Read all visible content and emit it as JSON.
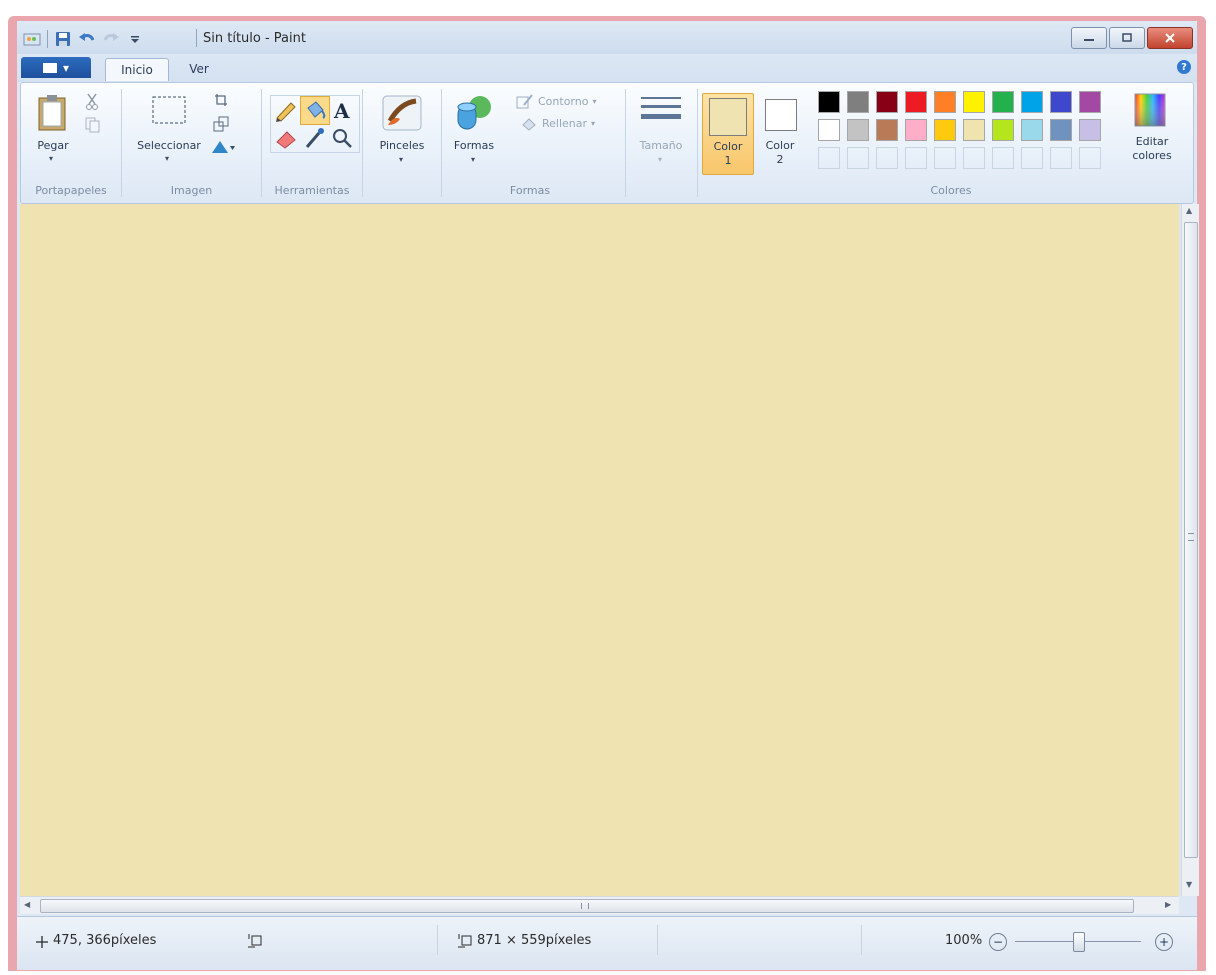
{
  "titlebar": {
    "title": "Sin título - Paint"
  },
  "tabs": {
    "inicio": "Inicio",
    "ver": "Ver"
  },
  "ribbon": {
    "portapapeles": {
      "paste_label": "Pegar",
      "group_label": "Portapapeles"
    },
    "imagen": {
      "select_label": "Seleccionar",
      "group_label": "Imagen"
    },
    "herramientas": {
      "group_label": "Herramientas"
    },
    "pinceles": {
      "label": "Pinceles"
    },
    "formas": {
      "shapes_label": "Formas",
      "outline_label": "Contorno",
      "fill_label": "Rellenar",
      "group_label": "Formas"
    },
    "tamano": {
      "label": "Tamaño"
    },
    "colores": {
      "color1_label": "Color",
      "color1_num": "1",
      "color2_label": "Color",
      "color2_num": "2",
      "edit_label": "Editar colores",
      "group_label": "Colores",
      "color1_value": "#efe3b2",
      "color2_value": "#ffffff",
      "palette_row1": [
        "#000000",
        "#7f7f7f",
        "#880015",
        "#ed1c24",
        "#ff7f27",
        "#fff200",
        "#22b14c",
        "#00a2e8",
        "#3f48cc",
        "#a349a4"
      ],
      "palette_row2": [
        "#ffffff",
        "#c3c3c3",
        "#b97a57",
        "#ffaec9",
        "#ffc90e",
        "#efe4b0",
        "#b5e61d",
        "#99d9ea",
        "#7092be",
        "#c8bfe7"
      ]
    }
  },
  "canvas": {
    "background": "#efe3b2"
  },
  "status": {
    "cursor_pos": "475, 366píxeles",
    "image_size": "871 × 559píxeles",
    "zoom": "100%"
  }
}
